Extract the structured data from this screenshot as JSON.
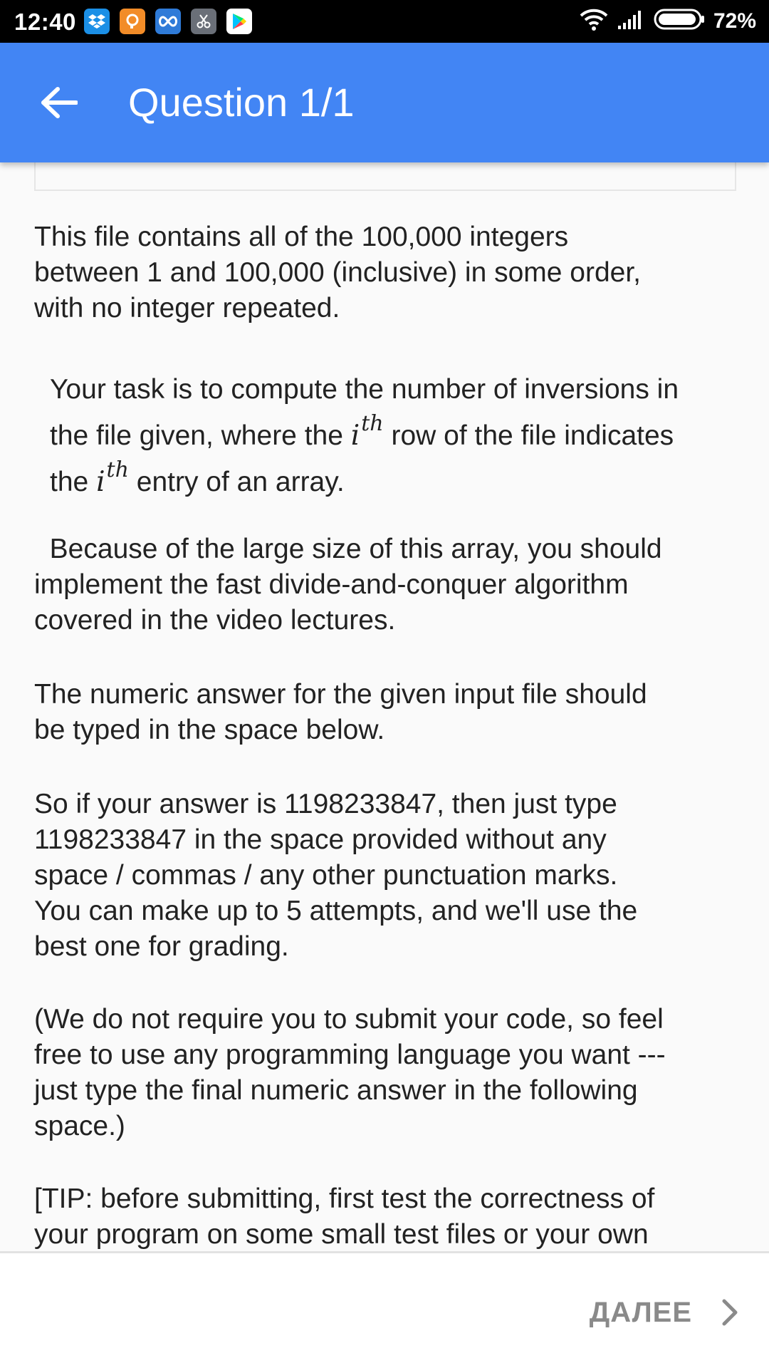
{
  "status_bar": {
    "time": "12:40",
    "battery_percent": "72%",
    "notification_icons": [
      "dropbox-icon",
      "chat-icon",
      "infinity-icon",
      "scissors-icon",
      "play-store-icon"
    ]
  },
  "app_bar": {
    "title": "Question 1/1",
    "color": "#4285f4"
  },
  "question": {
    "p1": "This file contains all of the 100,000 integers\nbetween 1 and 100,000 (inclusive) in some order,\nwith no integer repeated.",
    "p2_part1": "Your task is to compute the number of inversions in\nthe file given, where the ",
    "math_var": "i",
    "math_sup": "th",
    "p2_part2": " row of the file indicates\nthe ",
    "p2_part3": " entry of an array.",
    "p3": "  Because of the large size of this array, you should\nimplement the fast divide-and-conquer algorithm\ncovered in the video lectures.",
    "p4": "The numeric answer for the given input file should\nbe typed in the space below.",
    "p5": "So if your answer is 1198233847, then just type\n1198233847 in the space provided without any\nspace / commas / any other punctuation marks.\nYou can make up to 5 attempts, and we'll use the\nbest one for grading.",
    "p6": "(We do not require you to submit your code, so feel\nfree to use any programming language you want ---\njust type the final numeric answer in the following\nspace.)",
    "p7": "[TIP: before submitting, first test the correctness of\nyour program on some small test files or your own"
  },
  "bottom_bar": {
    "next_label": "ДАЛЕЕ"
  }
}
